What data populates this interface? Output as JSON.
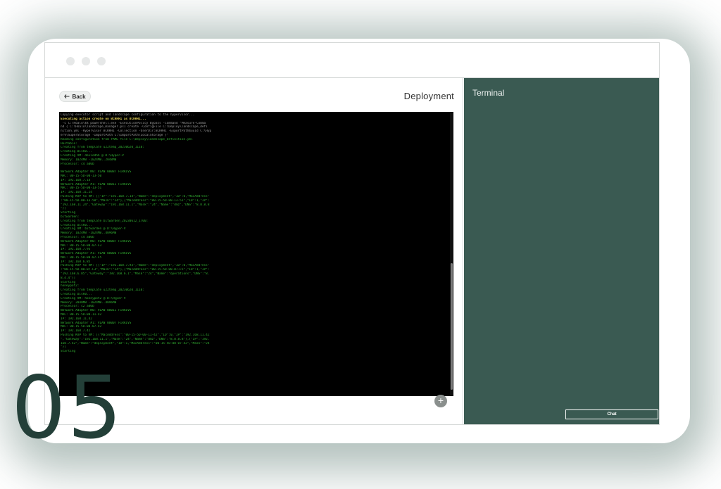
{
  "window": {
    "back_label": "Back",
    "title": "Deployment",
    "terminal_title": "Terminal",
    "chat_label": "Chat",
    "add_symbol": "+"
  },
  "console": {
    "lines": [
      {
        "text": "Copying executor script and landscape configuration to the hypervisor...",
        "style": "dim"
      },
      {
        "text": "Executing action create on BCRRH1 as BCRRH1...",
        "style": "bright"
      },
      {
        "text": " -c C:\\Hoalo\\$$ powershell.exe -ExecutionPolicy Bypass -Command \"Measure-Comma",
        "style": "dim"
      },
      {
        "text": "nd { C:\\Hoalo\\landscape_manager.ps1 create -ConfigFile C:\\Deploy\\landscape_defi",
        "style": "dim"
      },
      {
        "text": "nition.yml -Hypervisor BCRRH1 -Collection -UserDir:BCRRH1 -ExportPath$uuid C:\\Hyp",
        "style": "dim"
      },
      {
        "text": "erV\\SuperStorage -ImportPath C:\\ImportPath\\LocalStorage }\"",
        "style": "dim"
      },
      {
        "text": "Reading configuration from YAML file C:\\Deploy\\landscape_definition.yml",
        "style": "normal"
      },
      {
        "text": "Hostable:",
        "style": "normal"
      },
      {
        "text": "Creating from template u22temp_20230620_1110:",
        "style": "normal"
      },
      {
        "text": "Creating Disk0...",
        "style": "normal"
      },
      {
        "text": "Creating VM: deviodhh @ D:\\Hyper-V",
        "style": "normal"
      },
      {
        "text": "Memory: 1024MB -1024MB..2048MB",
        "style": "normal"
      },
      {
        "text": "Processor: c4 a00b",
        "style": "normal"
      },
      {
        "text": "",
        "style": "normal"
      },
      {
        "text": "Network Adapter N0: VLAN 00087 FIRRIVS",
        "style": "normal"
      },
      {
        "text": "MAC: 00-15-5D-00-13-50",
        "style": "normal"
      },
      {
        "text": "IP: 192.168.7.14",
        "style": "normal"
      },
      {
        "text": "Network Adapter #1: VLAN 00011 FIRRIVS",
        "style": "normal"
      },
      {
        "text": "MAC: 00-15-5D-00-13-51",
        "style": "normal"
      },
      {
        "text": "IP: 192.168.11.24",
        "style": "normal"
      },
      {
        "text": "Pushing KVP to VM: [{\"IP\":\"192.168.7.14\",\"Name\":\"deployment\",\"ID\":0,\"MacAddress\"",
        "style": "normal"
      },
      {
        "text": ":\"00-15-5D-00-13-50\",\"Mask\":\"24\"},{\"MacAddress\":\"00-15-5D-00-13-51\",\"ID\":1,\"IP\":",
        "style": "normal"
      },
      {
        "text": "\"192.168.11.24\",\"Gateway\":\"192.168.11.1\",\"Mask\":\"24\",\"Name\":\"dmz\",\"DNS\":\"8.8.8.8",
        "style": "normal"
      },
      {
        "text": "\"}]",
        "style": "normal"
      },
      {
        "text": "Starting",
        "style": "normal"
      },
      {
        "text": "bitwarden:",
        "style": "normal"
      },
      {
        "text": "Creating from template bitwarden_20230612_1700:",
        "style": "normal"
      },
      {
        "text": "Creating Disk0...",
        "style": "normal"
      },
      {
        "text": "Creating VM: bitwarden @ D:\\Hyper-V",
        "style": "normal"
      },
      {
        "text": "Memory: 1024MB -1024MB..4096MB",
        "style": "normal"
      },
      {
        "text": "Processor: c4 a00b",
        "style": "normal"
      },
      {
        "text": "Network Adapter N0: VLAN 00087 FIRRIVS",
        "style": "normal"
      },
      {
        "text": "MAC: 00-15-5D-00-07-F3",
        "style": "normal"
      },
      {
        "text": "IP: 192.168.7.93",
        "style": "normal"
      },
      {
        "text": "Network Adapter #1: VLAN 00006 FIRRIVS",
        "style": "normal"
      },
      {
        "text": "MAC: 00-15-5D-00-07-F5",
        "style": "normal"
      },
      {
        "text": "IP: 192.168.6.85",
        "style": "normal"
      },
      {
        "text": "Pushing KVP to VM: [{\"IP\":\"192.168.7.93\",\"Name\":\"deployment\",\"ID\":0,\"MacAddress\"",
        "style": "normal"
      },
      {
        "text": ":\"00-15-5D-00-07-F3\",\"Mask\":\"24\"},{\"MacAddress\":\"00-15-5D-00-07-F5\",\"ID\":1,\"IP\":",
        "style": "normal"
      },
      {
        "text": "\"192.168.6.85\",\"Gateway\":\"192.168.6.1\",\"Mask\":\"24\",\"Name\":\"operations\",\"DNS\":\"8.",
        "style": "normal"
      },
      {
        "text": "8.4.4\"}]",
        "style": "normal"
      },
      {
        "text": "Starting",
        "style": "normal"
      },
      {
        "text": "honeypot2:",
        "style": "normal"
      },
      {
        "text": "Creating from template u22temp_20230620_1110:",
        "style": "normal"
      },
      {
        "text": "Creating Disk0...",
        "style": "normal"
      },
      {
        "text": "Creating VM: honeypot2 @ D:\\Hyper-V",
        "style": "normal"
      },
      {
        "text": "Memory: 2048MB -1024MB..4096MB",
        "style": "normal"
      },
      {
        "text": "Processor: c2 a00b",
        "style": "normal"
      },
      {
        "text": "Network Adapter N0: VLAN 00011 FIRRIVS",
        "style": "normal"
      },
      {
        "text": "MAC: 00-15-5D-00-11-42",
        "style": "normal"
      },
      {
        "text": "IP: 192.168.11.42",
        "style": "normal"
      },
      {
        "text": "Network Adapter #1: VLAN 00007 FIRRIVS",
        "style": "normal"
      },
      {
        "text": "MAC: 00-15-5D-00-07-42",
        "style": "normal"
      },
      {
        "text": "IP: 192.168.7.42",
        "style": "normal"
      },
      {
        "text": "Pushing KVP to VM: [{\"MacAddress\":\"00-15-5D-00-11-42\",\"ID\":0,\"IP\":\"192.168.11.42",
        "style": "normal"
      },
      {
        "text": "\",\"Gateway\":\"192.168.11.1\",\"Mask\":\"24\",\"Name\":\"dmz\",\"DNS\":\"8.8.8.8\"},{\"IP\":\"192.",
        "style": "normal"
      },
      {
        "text": "168.7.42\",\"Name\":\"deployment\",\"ID\":1,\"MacAddress\":\"00-15-5D-00-07-42\",\"Mask\":\"24",
        "style": "normal"
      },
      {
        "text": "\"}]",
        "style": "normal"
      },
      {
        "text": "Starting",
        "style": "normal"
      }
    ]
  },
  "overlay": {
    "number": "05"
  },
  "colors": {
    "terminal_panel": "#3a5a52",
    "console_background": "#000000",
    "console_text": "#33b033",
    "overlay_number": "#233f38"
  }
}
